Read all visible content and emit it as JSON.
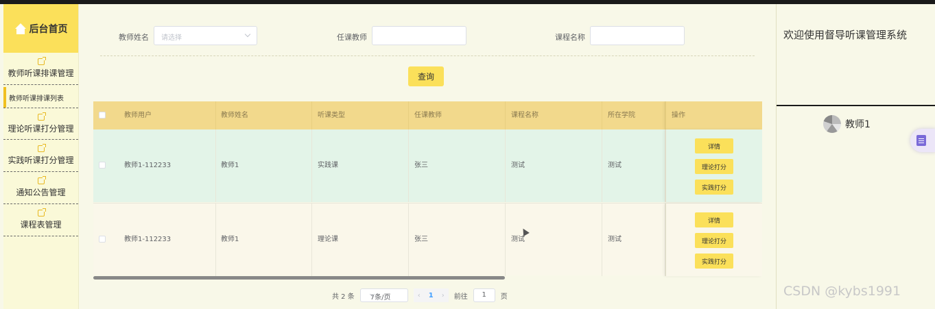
{
  "sidebar": {
    "home_title": "后台首页",
    "items": [
      {
        "label": "教师听课排课管理"
      },
      {
        "label": "理论听课打分管理"
      },
      {
        "label": "实践听课打分管理"
      },
      {
        "label": "通知公告管理"
      },
      {
        "label": "课程表管理"
      }
    ],
    "active_sub": "教师听课排课列表"
  },
  "filters": {
    "teacher_name_label": "教师姓名",
    "teacher_name_placeholder": "请选择",
    "lecturer_label": "任课教师",
    "lecturer_value": "",
    "course_label": "课程名称",
    "course_value": "",
    "query_label": "查询"
  },
  "table": {
    "headers": [
      "教师用户",
      "教师姓名",
      "听课类型",
      "任课教师",
      "课程名称",
      "所在学院",
      "操作"
    ],
    "rows": [
      {
        "user": "教师1-112233",
        "name": "教师1",
        "type": "实践课",
        "lecturer": "张三",
        "course": "测试",
        "college": "测试"
      },
      {
        "user": "教师1-112233",
        "name": "教师1",
        "type": "理论课",
        "lecturer": "张三",
        "course": "测试",
        "college": "测试"
      }
    ],
    "actions": {
      "detail": "详情",
      "theory": "理论打分",
      "practice": "实践打分"
    }
  },
  "pager": {
    "total": "共 2 条",
    "page_size": "7条/页",
    "prev": "‹",
    "current": "1",
    "next": "›",
    "goto_label": "前往",
    "goto_value": "1",
    "page_suffix": "页"
  },
  "right": {
    "welcome": "欢迎使用督导听课管理系统",
    "username": "教师1",
    "watermark": "CSDN @kybs1991"
  },
  "colors": {
    "accent": "#fbe05a",
    "header": "#f2d98c",
    "row_highlight": "#e3f4e8"
  }
}
